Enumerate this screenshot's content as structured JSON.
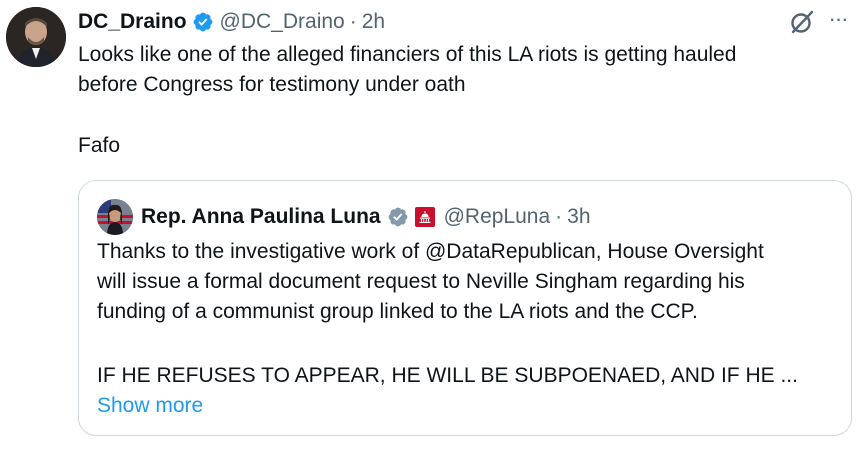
{
  "tweet": {
    "author_name": "DC_Draino",
    "handle": "@DC_Draino",
    "separator": "·",
    "time": "2h",
    "avatar_icon": "user-avatar-photo",
    "verified_icon": "verified-badge-icon",
    "grok_icon": "grok-icon",
    "more_icon": "more-options-icon",
    "more_label": "···",
    "text_lines": [
      "Looks like one of the alleged financiers of this LA riots is getting hauled",
      "before Congress for testimony under oath"
    ],
    "text_extra": "Fafo"
  },
  "quote": {
    "author_name": "Rep. Anna Paulina Luna",
    "handle": "@RepLuna",
    "separator": "·",
    "time": "3h",
    "avatar_icon": "user-avatar-photo",
    "verified_icon": "verified-badge-gray-icon",
    "affiliation_icon": "house-of-representatives-badge-icon",
    "text_lines": [
      "Thanks to the investigative work of @DataRepublican, House Oversight",
      "will issue a formal document request to Neville Singham regarding his",
      "funding of a communist group linked to the LA riots and the CCP."
    ],
    "caps_line": "IF HE REFUSES TO APPEAR, HE WILL BE SUBPOENAED, AND IF HE ...",
    "show_more": "Show more"
  },
  "colors": {
    "text": "#0f1419",
    "secondary": "#536471",
    "link": "#1d9bf0",
    "verified_blue": "#1d9bf0",
    "verified_gray": "#829aab",
    "border": "#cfd9de",
    "house_badge": "#c8102e"
  }
}
